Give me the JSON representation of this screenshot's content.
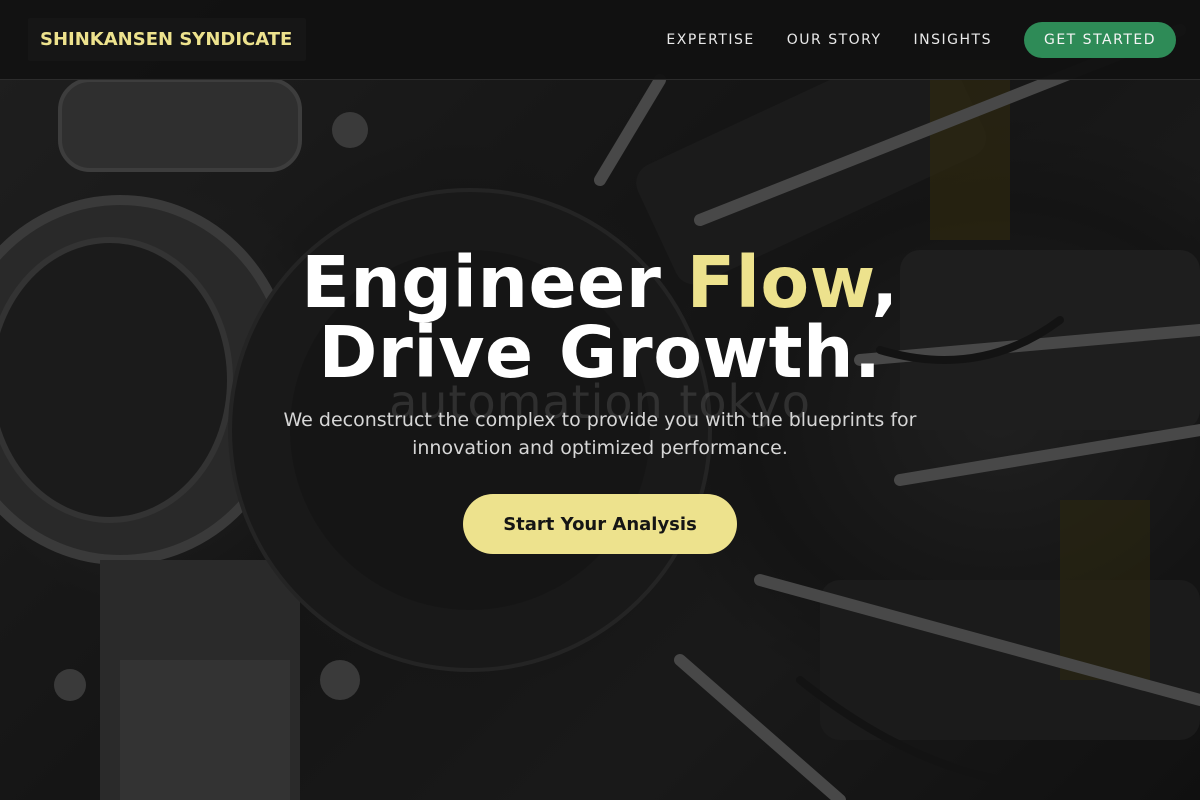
{
  "header": {
    "logo": "SHINKANSEN SYNDICATE",
    "nav": [
      {
        "label": "EXPERTISE"
      },
      {
        "label": "OUR STORY"
      },
      {
        "label": "INSIGHTS"
      }
    ],
    "cta_label": "GET STARTED"
  },
  "hero": {
    "headline_part1": "Engineer ",
    "headline_accent": "Flow",
    "headline_part2": ",",
    "headline_line2": "Drive Growth.",
    "subtitle": "We deconstruct the complex to provide you with the blueprints for innovation and optimized performance.",
    "cta_label": "Start Your Analysis",
    "watermark": "automation tokyo"
  },
  "colors": {
    "accent": "#ede28d",
    "cta_green": "#2e8b57",
    "header_bg": "#121212"
  }
}
